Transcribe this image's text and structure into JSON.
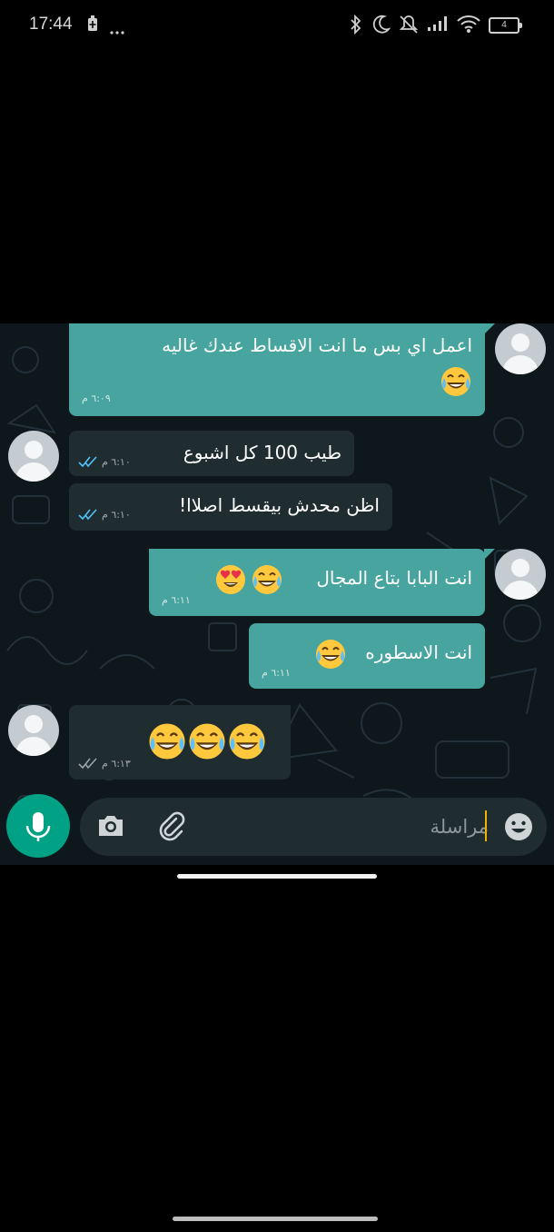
{
  "status_bar": {
    "time": "17:44",
    "battery_level": "4",
    "icons": [
      "battery-saver-icon",
      "more-icon",
      "bluetooth-icon",
      "do-not-disturb-icon",
      "mute-icon",
      "signal-icon",
      "wifi-icon",
      "battery-icon"
    ]
  },
  "messages": [
    {
      "direction": "out",
      "text_line1": "اعمل اي بس ما انت الاقساط عندك غاليه",
      "emojis": [
        "tears-of-joy"
      ],
      "time": "٦:٠٩ م",
      "ticks": false
    },
    {
      "direction": "in",
      "text": "طيب 100 كل اشبوع",
      "time": "٦:١٠ م",
      "ticks": true,
      "ticks_color": "#4fc3f7"
    },
    {
      "direction": "in",
      "text": "اظن محدش بيقسط اصلاا!",
      "time": "٦:١٠ م",
      "ticks": true,
      "ticks_color": "#4fc3f7"
    },
    {
      "direction": "out",
      "text": "انت البابا بتاع المجال",
      "emojis": [
        "tears-of-joy",
        "heart-eyes"
      ],
      "time": "٦:١١ م",
      "ticks": false
    },
    {
      "direction": "out",
      "text": "انت الاسطوره",
      "emojis": [
        "tears-of-joy"
      ],
      "time": "٦:١١ م",
      "ticks": false
    },
    {
      "direction": "in",
      "text": "",
      "emojis": [
        "tears-of-joy",
        "tears-of-joy",
        "tears-of-joy"
      ],
      "time": "٦:١٣ م",
      "ticks": true,
      "ticks_color": "#9aa3a6"
    }
  ],
  "composer": {
    "placeholder": "مراسلة",
    "icons": [
      "mic-icon",
      "camera-icon",
      "attach-icon",
      "emoji-icon"
    ]
  },
  "colors": {
    "outgoing_bubble": "#48a49f",
    "incoming_bubble": "#1f2c30",
    "chat_background": "#0e171b",
    "mic_button": "#00a184",
    "read_ticks": "#4fc3f7"
  }
}
